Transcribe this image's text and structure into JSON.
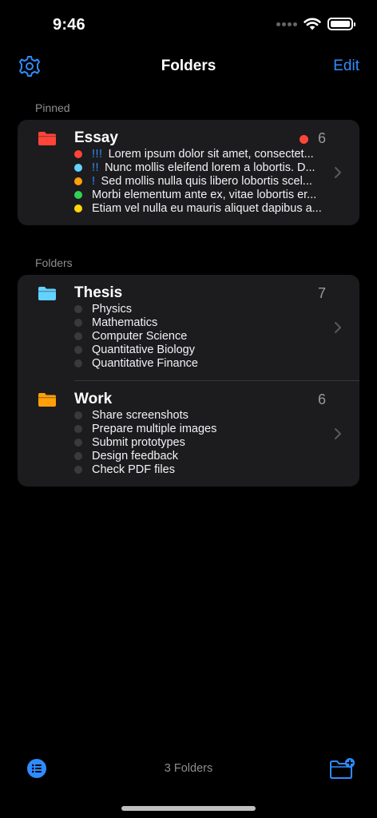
{
  "status": {
    "time": "9:46"
  },
  "nav": {
    "title": "Folders",
    "edit_label": "Edit"
  },
  "sections": {
    "pinned": "Pinned",
    "folders": "Folders"
  },
  "pinned": {
    "name": "Essay",
    "count": "6",
    "color": "#ff453a",
    "has_unread": true,
    "items": [
      {
        "priority": "!!!",
        "text": "Lorem ipsum dolor sit amet, consectet...",
        "color": "#ff453a"
      },
      {
        "priority": "!!",
        "text": "Nunc mollis eleifend lorem a lobortis. D...",
        "color": "#64d2ff"
      },
      {
        "priority": "!",
        "text": "Sed mollis nulla quis libero lobortis scel...",
        "color": "#ff9f0a"
      },
      {
        "priority": "",
        "text": "Morbi elementum ante ex, vitae lobortis er...",
        "color": "#30d158"
      },
      {
        "priority": "",
        "text": "Etiam vel nulla eu mauris aliquet dapibus a...",
        "color": "#ffd60a"
      }
    ]
  },
  "folders": [
    {
      "name": "Thesis",
      "count": "7",
      "color": "#64d2ff",
      "items": [
        "Physics",
        "Mathematics",
        "Computer Science",
        "Quantitative Biology",
        "Quantitative Finance"
      ]
    },
    {
      "name": "Work",
      "count": "6",
      "color": "#ff9f0a",
      "items": [
        "Share screenshots",
        "Prepare multiple images",
        "Submit prototypes",
        "Design feedback",
        "Check PDF files"
      ]
    }
  ],
  "toolbar": {
    "count_label": "3 Folders"
  },
  "accent": "#2f8cff",
  "icons": {
    "settings": "gear-icon",
    "list": "list-icon",
    "new_folder": "new-folder-icon",
    "chevron": "chevron-right-icon",
    "folder": "folder-icon"
  }
}
